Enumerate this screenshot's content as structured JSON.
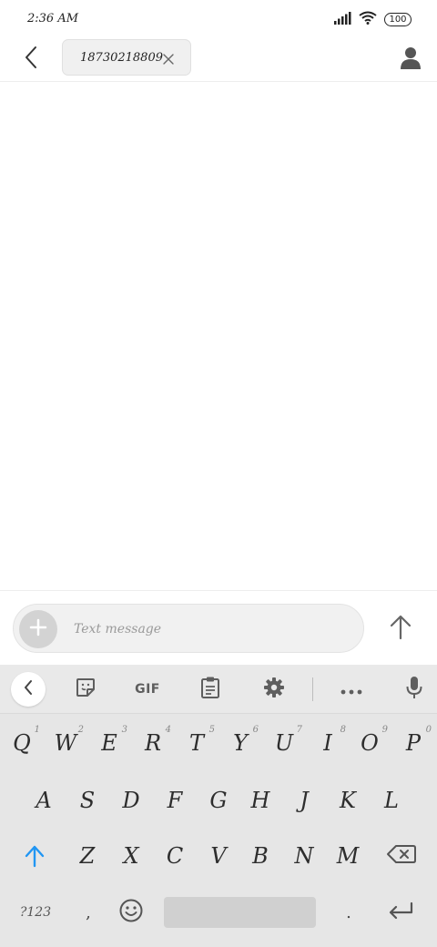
{
  "status_bar": {
    "time": "2:36 AM",
    "battery": "100",
    "icons": [
      "signal-icon",
      "wifi-icon",
      "battery-icon"
    ]
  },
  "header": {
    "recipient": "18730218809",
    "icons": [
      "back-arrow-icon",
      "remove-recipient-icon",
      "contact-icon"
    ]
  },
  "compose": {
    "placeholder": "Text message",
    "icons": [
      "add-icon",
      "send-icon"
    ]
  },
  "keyboard": {
    "toolbar": {
      "gif_label": "GIF",
      "icons": [
        "collapse-icon",
        "sticker-icon",
        "clipboard-icon",
        "settings-icon",
        "more-icon",
        "microphone-icon"
      ]
    },
    "row1": [
      {
        "key": "Q",
        "hint": "1"
      },
      {
        "key": "W",
        "hint": "2"
      },
      {
        "key": "E",
        "hint": "3"
      },
      {
        "key": "R",
        "hint": "4"
      },
      {
        "key": "T",
        "hint": "5"
      },
      {
        "key": "Y",
        "hint": "6"
      },
      {
        "key": "U",
        "hint": "7"
      },
      {
        "key": "I",
        "hint": "8"
      },
      {
        "key": "O",
        "hint": "9"
      },
      {
        "key": "P",
        "hint": "0"
      }
    ],
    "row2": [
      "A",
      "S",
      "D",
      "F",
      "G",
      "H",
      "J",
      "K",
      "L"
    ],
    "row3": [
      "Z",
      "X",
      "C",
      "V",
      "B",
      "N",
      "M"
    ],
    "bottom": {
      "symbols_label": "?123",
      "comma": ",",
      "period": "."
    },
    "accent_color": "#2196f3"
  }
}
